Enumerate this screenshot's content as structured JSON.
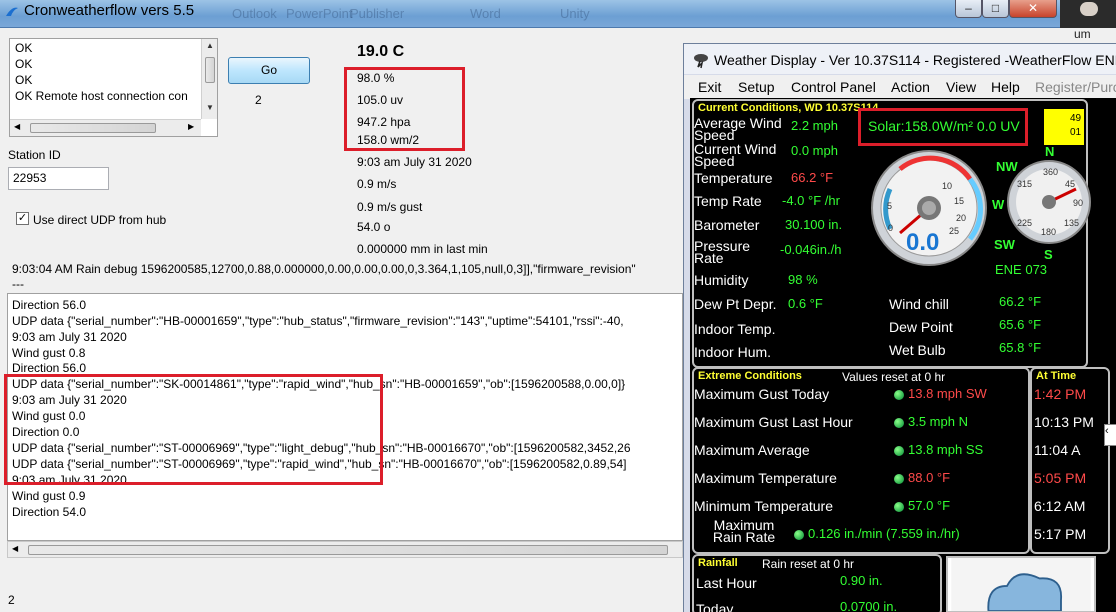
{
  "left_app": {
    "title": "Cronweatherflow vers 5.5",
    "bg_menu": [
      "Outlook",
      "PowerPoint",
      "Publisher",
      "Word",
      "Unity"
    ],
    "window_controls": [
      "–",
      "□",
      "✕"
    ],
    "corner_text": "um",
    "messages": [
      "OK",
      "OK",
      "OK",
      "OK Remote host connection con"
    ],
    "go_label": "Go",
    "counter": "2",
    "station_label": "Station ID",
    "station_value": "22953",
    "udp_label": "Use direct UDP from hub",
    "udp_checked": "✓",
    "temperature": "19.0 C",
    "humidity": "98.0 %",
    "uv": "105.0 uv",
    "pressure": "947.2 hpa",
    "solar": "158.0 wm/2",
    "timestamp": "9:03 am July 31 2020",
    "wind": "0.9 m/s",
    "gust": "0.9 m/s gust",
    "direction": "54.0 o",
    "rain": "0.000000 mm in last min",
    "rain_debug": "9:03:04 AM Rain debug 1596200585,12700,0.88,0.000000,0.00,0.00,0.00,0,3.364,1,105,null,0,3]],\"firmware_revision\"",
    "rain_dash": "---",
    "log_lines": [
      "Direction 56.0",
      "UDP data {\"serial_number\":\"HB-00001659\",\"type\":\"hub_status\",\"firmware_revision\":\"143\",\"uptime\":54101,\"rssi\":-40,",
      "9:03 am July 31 2020",
      "Wind gust 0.8",
      "Direction 56.0",
      "UDP data {\"serial_number\":\"SK-00014861\",\"type\":\"rapid_wind\",\"hub_sn\":\"HB-00001659\",\"ob\":[1596200588,0.00,0]}",
      "9:03 am July 31 2020",
      "Wind gust 0.0",
      "Direction 0.0",
      "UDP data {\"serial_number\":\"ST-00006969\",\"type\":\"light_debug\",\"hub_sn\":\"HB-00016670\",\"ob\":[1596200582,3452,26",
      "UDP data {\"serial_number\":\"ST-00006969\",\"type\":\"rapid_wind\",\"hub_sn\":\"HB-00016670\",\"ob\":[1596200582,0.89,54]",
      "9:03 am July 31 2020",
      "Wind gust 0.9",
      "Direction 54.0"
    ],
    "bottom_counter": "2"
  },
  "weather_display": {
    "title": "Weather Display - Ver 10.37S114 - Registered  -WeatherFlow ENE,",
    "menu": [
      "Exit",
      "Setup",
      "Control Panel",
      "Action",
      "View",
      "Help",
      "Register/Purc"
    ],
    "current_header": "Current Conditions, WD 10.37S114",
    "solar_text": "Solar:158.0W/m² 0.0 UV",
    "yellow_box": [
      "49",
      "01"
    ],
    "rows": [
      {
        "label": "Average Wind Speed",
        "value": "2.2 mph"
      },
      {
        "label": "Current Wind Speed",
        "value": "0.0 mph"
      },
      {
        "label": "Temperature",
        "value": "66.2 °F"
      },
      {
        "label": "Temp Rate",
        "value": "-4.0 °F /hr"
      },
      {
        "label": "Barometer",
        "value": "30.100 in."
      },
      {
        "label": "Pressure Rate",
        "value": "-0.046in./h"
      },
      {
        "label": "Humidity",
        "value": "98 %"
      },
      {
        "label": "Dew Pt Depr.",
        "value": "0.6 °F"
      },
      {
        "label": "Indoor Temp.",
        "value": ""
      },
      {
        "label": "Indoor Hum.",
        "value": ""
      }
    ],
    "right_rows": [
      {
        "label": "Wind chill",
        "value": "66.2 °F"
      },
      {
        "label": "Dew Point",
        "value": "65.6 °F"
      },
      {
        "label": "Wet Bulb",
        "value": "65.8 °F"
      }
    ],
    "gauge_value": "0.0",
    "gauge_ticks": [
      "0",
      "5",
      "10",
      "15",
      "20",
      "25"
    ],
    "compass": [
      "N",
      "NW",
      "W",
      "SW",
      "S"
    ],
    "compass_ticks": [
      "360",
      "45",
      "90",
      "135",
      "180",
      "225",
      "315"
    ],
    "compass_readout": "ENE  073",
    "extreme_header": "Extreme Conditions",
    "extreme_reset": "Values reset at 0 hr",
    "at_time_header": "At Time",
    "extremes": [
      {
        "label": "Maximum Gust Today",
        "value": "13.8 mph SW",
        "time": "1:42 PM"
      },
      {
        "label": "Maximum Gust Last Hour",
        "value": "3.5 mph N",
        "time": "10:13 PM"
      },
      {
        "label": "Maximum Average",
        "value": "13.8 mph SS",
        "time": "11:04 A"
      },
      {
        "label": "Maximum Temperature",
        "value": "88.0 °F",
        "time": "5:05 PM"
      },
      {
        "label": "Minimum Temperature",
        "value": "57.0 °F",
        "time": "6:12 AM"
      },
      {
        "label": "Maximum Rain Rate",
        "value": "0.126 in./min (7.559 in./hr)",
        "time": "5:17 PM"
      }
    ],
    "rainfall_header": "Rainfall",
    "rainfall_reset": "Rain reset at 0 hr",
    "rainfall": [
      {
        "label": "Last Hour",
        "value": "0.90 in."
      },
      {
        "label": "Today",
        "value": "0.0700 in."
      }
    ]
  },
  "colors": {
    "highlight": "#dc1e2a",
    "wd_value": "#33ff33",
    "wd_alert": "#ff4a4a"
  }
}
